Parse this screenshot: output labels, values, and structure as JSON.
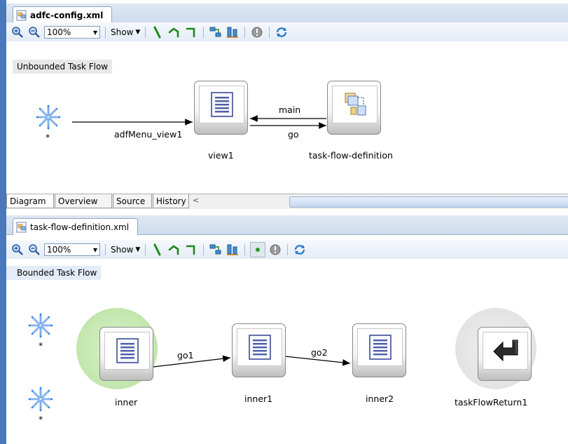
{
  "top_editor": {
    "file_tab": "adfc-config.xml",
    "zoom_value": "100%",
    "show_label": "Show",
    "flow_label": "Unbounded Task Flow",
    "start_label": "*",
    "nodes": {
      "view1": "view1",
      "task_flow_definition": "task-flow-definition"
    },
    "edges": {
      "menu": "adfMenu_view1",
      "main": "main",
      "go": "go"
    },
    "bottom_tabs": [
      "Diagram",
      "Overview",
      "Source",
      "History"
    ]
  },
  "bottom_editor": {
    "file_tab": "task-flow-definition.xml",
    "zoom_value": "100%",
    "show_label": "Show",
    "flow_label": "Bounded Task Flow",
    "start_label_1": "*",
    "start_label_2": "*",
    "nodes": {
      "inner": "inner",
      "inner1": "inner1",
      "inner2": "inner2",
      "task_flow_return": "taskFlowReturn1"
    },
    "edges": {
      "go1": "go1",
      "go2": "go2"
    }
  },
  "colors": {
    "tab_strip": "#cfdced",
    "left_bar": "#4a78b8",
    "default_activity_halo": "#c9ebb8",
    "return_halo": "#e2e2e2",
    "page_icon": "#4d5fa8"
  },
  "icons": [
    "zoom-in-icon",
    "zoom-out-icon",
    "control-flow-icon",
    "wildcard-flow-icon",
    "return-flow-icon",
    "auto-layout-icon",
    "align-icon",
    "warning-icon",
    "refresh-icon",
    "page-icon",
    "task-flow-call-icon",
    "wildcard-icon",
    "return-arrow-icon"
  ]
}
